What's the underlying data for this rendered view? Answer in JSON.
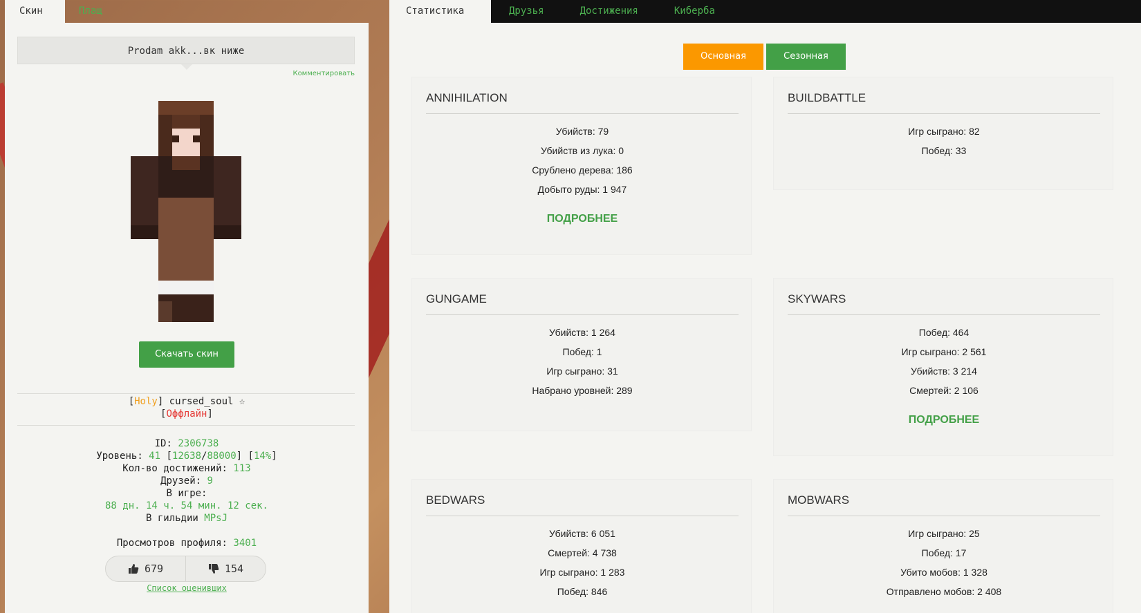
{
  "left_tabs": [
    "Скин",
    "Плащ"
  ],
  "status_comment": "Prodam akk...вк ниже",
  "comment_link": "Комментировать",
  "download_skin": "Скачать скин",
  "player": {
    "guild_prefix": "[",
    "guild_tag": "Holy",
    "guild_suffix": "]",
    "name": " cursed_soul ☆",
    "status_open": "[",
    "status": "Оффлайн",
    "status_close": "]"
  },
  "info": {
    "id_label": "ID: ",
    "id_value": "2306738",
    "level_label": "Уровень: ",
    "level_value": "41",
    "level_lb": " [",
    "level_xp": "12638",
    "level_sep": "/",
    "level_xp_max": "88000",
    "level_mid": "] [",
    "level_pct": "14%",
    "level_rb": "]",
    "ach_label": "Кол-во достижений: ",
    "ach_value": "113",
    "friends_label": "Друзей: ",
    "friends_value": "9",
    "ingame_label": "В игре:",
    "ingame_value": "88 дн. 14 ч. 54 мин. 12 сек.",
    "guild_label": "В гильдии ",
    "guild_value": "MPsJ",
    "views_label": "Просмотров профиля: ",
    "views_value": "3401"
  },
  "votes": {
    "likes": "679",
    "dislikes": "154"
  },
  "voters_link": "Список оценивших",
  "right_tabs": [
    "Статистика",
    "Друзья",
    "Достижения",
    "Киберба"
  ],
  "mode_buttons": {
    "main": "Основная",
    "season": "Сезонная"
  },
  "more_label": "ПОДРОБНЕЕ",
  "stats": {
    "annihilation": {
      "title": "ANNIHILATION",
      "lines": [
        "Убийств: 79",
        "Убийств из лука: 0",
        "Срублено дерева: 186",
        "Добыто руды: 1 947"
      ]
    },
    "buildbattle": {
      "title": "BUILDBATTLE",
      "lines": [
        "Игр сыграно: 82",
        "Побед: 33"
      ]
    },
    "gungame": {
      "title": "GUNGAME",
      "lines": [
        "Убийств: 1 264",
        "Побед: 1",
        "Игр сыграно: 31",
        "Набрано уровней: 289"
      ]
    },
    "skywars": {
      "title": "SKYWARS",
      "lines": [
        "Побед: 464",
        "Игр сыграно: 2 561",
        "Убийств: 3 214",
        "Смертей: 2 106"
      ]
    },
    "bedwars": {
      "title": "BEDWARS",
      "lines": [
        "Убийств: 6 051",
        "Смертей: 4 738",
        "Игр сыграно: 1 283",
        "Побед: 846"
      ]
    },
    "mobwars": {
      "title": "MOBWARS",
      "lines": [
        "Игр сыграно: 25",
        "Побед: 17",
        "Убито мобов: 1 328",
        "Отправлено мобов: 2 408"
      ]
    }
  }
}
